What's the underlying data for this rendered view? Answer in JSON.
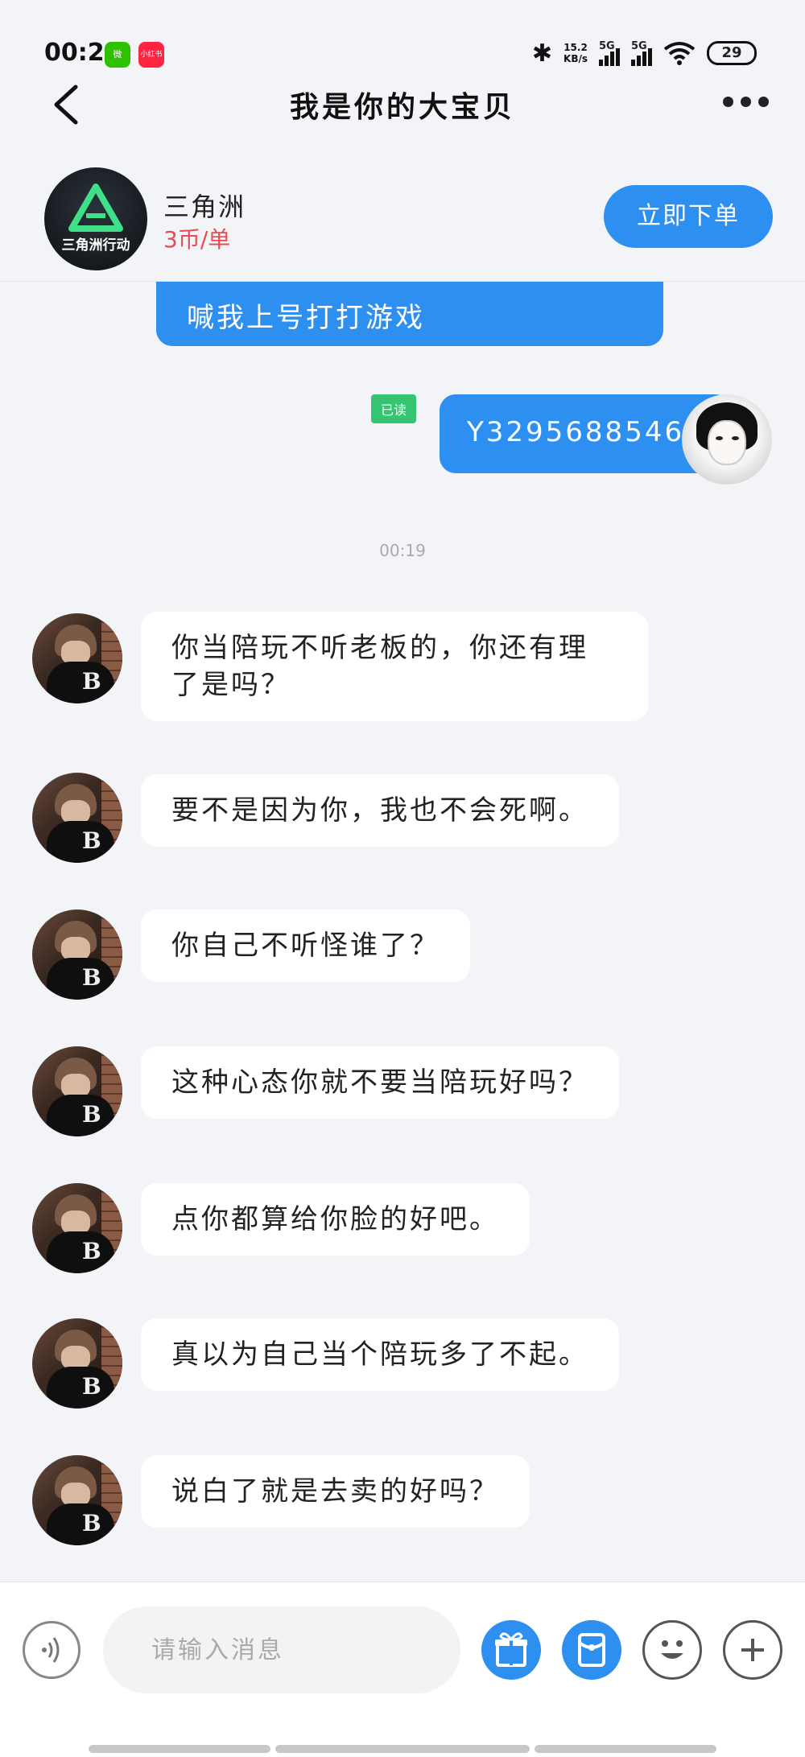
{
  "status_bar": {
    "time": "00:21",
    "wechat_label": "微",
    "redbook_label": "小红书",
    "net_speed_value": "15.2",
    "net_speed_unit": "KB/s",
    "signal1_label": "5G",
    "signal2_label": "5G",
    "battery": "29"
  },
  "header": {
    "title": "我是你的大宝贝"
  },
  "product": {
    "logo_text": "三角洲行动",
    "name": "三角洲",
    "price": "3币/单",
    "order_button": "立即下单"
  },
  "messages": [
    {
      "side": "out",
      "text": "喊我上号打打游戏",
      "partial": true
    },
    {
      "side": "out",
      "text": "Y3295688546u",
      "read_label": "已读"
    },
    {
      "side": "timestamp",
      "text": "00:19"
    },
    {
      "side": "in",
      "text": "你当陪玩不听老板的，你还有理了是吗？"
    },
    {
      "side": "in",
      "text": "要不是因为你，我也不会死啊。"
    },
    {
      "side": "in",
      "text": "你自己不听怪谁了？"
    },
    {
      "side": "in",
      "text": "这种心态你就不要当陪玩好吗？"
    },
    {
      "side": "in",
      "text": "点你都算给你脸的好吧。"
    },
    {
      "side": "in",
      "text": "真以为自己当个陪玩多了不起。"
    },
    {
      "side": "in",
      "text": "说白了就是去卖的好吗？"
    }
  ],
  "input": {
    "placeholder": "请输入消息"
  },
  "icons": {
    "gift": "gift-icon",
    "red_packet": "red-packet-icon",
    "emoji": "emoji-icon",
    "plus": "plus-icon",
    "voice": "voice-icon"
  },
  "colors": {
    "accent": "#2d8fef",
    "price": "#e94b55",
    "read_badge": "#35c470",
    "background": "#f2f4f7"
  }
}
